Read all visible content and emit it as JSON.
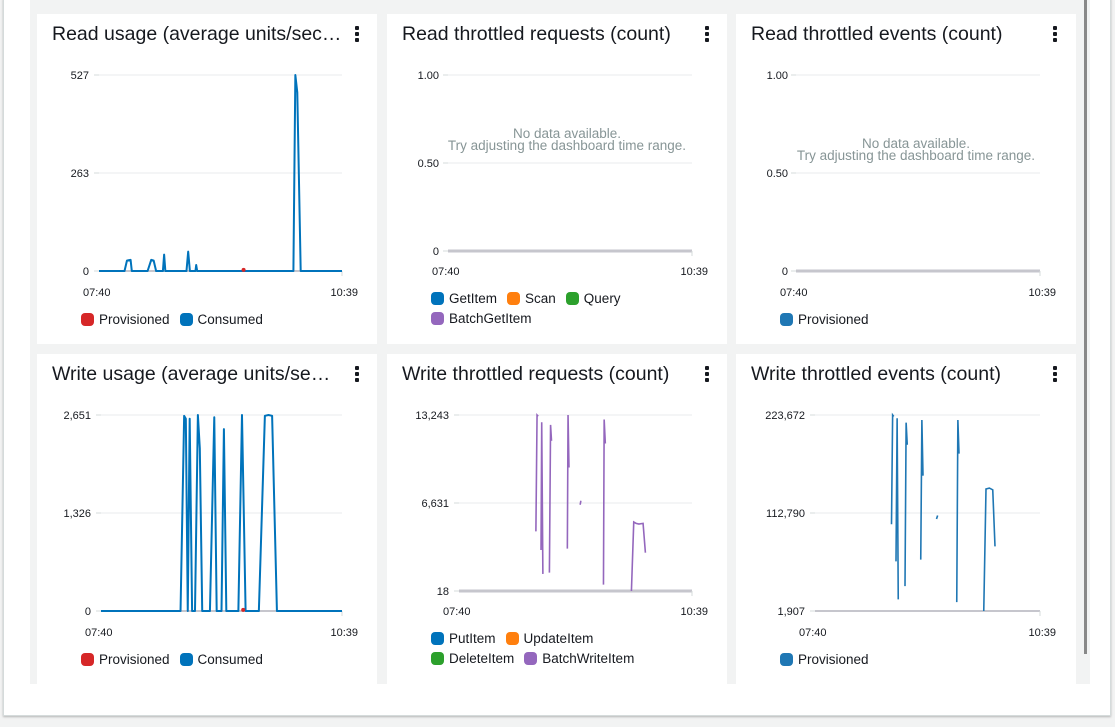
{
  "colors": {
    "blue": "#0073bb",
    "red": "#d62728",
    "orange": "#ff7f0e",
    "green": "#2ca02c",
    "purple": "#9467bd",
    "event_blue": "#1f77b4",
    "grid": "#e9ebed",
    "baseline": "#c6c6cd"
  },
  "no_data": {
    "line1": "No data available.",
    "line2": "Try adjusting the dashboard time range."
  },
  "chart_data": [
    {
      "id": "read-usage",
      "type": "line",
      "title": "Read usage (average units/sec…",
      "menu_icon": "more-vertical-icon",
      "xlabel": "",
      "ylabel": "",
      "x_ticks": [
        "07:40",
        "10:39"
      ],
      "y_ticks": [
        "527",
        "263",
        "0"
      ],
      "ylim": [
        0,
        527
      ],
      "legend": [
        {
          "name": "Provisioned",
          "color": "#d62728"
        },
        {
          "name": "Consumed",
          "color": "#0073bb"
        }
      ],
      "series": [
        {
          "name": "Consumed",
          "color": "#0073bb",
          "x": [
            0,
            0.105,
            0.115,
            0.13,
            0.135,
            0.2,
            0.215,
            0.225,
            0.235,
            0.263,
            0.268,
            0.273,
            0.36,
            0.367,
            0.374,
            0.397,
            0.4,
            0.404,
            0.8,
            0.808,
            0.816,
            0.83,
            1.0
          ],
          "y": [
            0,
            0,
            28,
            30,
            0,
            0,
            30,
            28,
            0,
            0,
            44,
            0,
            0,
            52,
            0,
            0,
            16,
            0,
            0,
            527,
            480,
            0,
            0
          ]
        },
        {
          "name": "Provisioned",
          "color": "#d62728",
          "points": [
            [
              0.595,
              3
            ]
          ]
        }
      ],
      "grid": true
    },
    {
      "id": "read-throttled-requests",
      "type": "line",
      "title": "Read throttled requests (count)",
      "menu_icon": "more-vertical-icon",
      "x_ticks": [
        "07:40",
        "10:39"
      ],
      "y_ticks": [
        "1.00",
        "0.50",
        "0"
      ],
      "ylim": [
        0,
        1
      ],
      "no_data": true,
      "legend": [
        {
          "name": "GetItem",
          "color": "#0073bb"
        },
        {
          "name": "Scan",
          "color": "#ff7f0e"
        },
        {
          "name": "Query",
          "color": "#2ca02c"
        },
        {
          "name": "BatchGetItem",
          "color": "#9467bd"
        }
      ],
      "series": [],
      "grid": true
    },
    {
      "id": "read-throttled-events",
      "type": "line",
      "title": "Read throttled events (count)",
      "menu_icon": "more-vertical-icon",
      "x_ticks": [
        "07:40",
        "10:39"
      ],
      "y_ticks": [
        "1.00",
        "0.50",
        "0"
      ],
      "ylim": [
        0,
        1
      ],
      "no_data": true,
      "legend": [
        {
          "name": "Provisioned",
          "color": "#1f77b4"
        }
      ],
      "series": [],
      "grid": true
    },
    {
      "id": "write-usage",
      "type": "line",
      "title": "Write usage (average units/se…",
      "menu_icon": "more-vertical-icon",
      "x_ticks": [
        "07:40",
        "10:39"
      ],
      "y_ticks": [
        "2,651",
        "1,326",
        "0"
      ],
      "ylim": [
        0,
        2651
      ],
      "legend": [
        {
          "name": "Provisioned",
          "color": "#d62728"
        },
        {
          "name": "Consumed",
          "color": "#0073bb"
        }
      ],
      "series": [
        {
          "name": "Consumed",
          "color": "#0073bb",
          "x": [
            0,
            0.33,
            0.345,
            0.352,
            0.36,
            0.368,
            0.378,
            0.39,
            0.402,
            0.41,
            0.42,
            0.44,
            0.452,
            0.47,
            0.48,
            0.5,
            0.51,
            0.52,
            0.535,
            0.558,
            0.57,
            0.585,
            0.6,
            0.615,
            0.618,
            0.63,
            0.64,
            0.655,
            0.68,
            0.695,
            0.71,
            0.73,
            1.0
          ],
          "y": [
            0,
            0,
            2640,
            2600,
            0,
            2600,
            0,
            0,
            2651,
            2200,
            0,
            0,
            0,
            2620,
            0,
            0,
            2460,
            0,
            0,
            0,
            0,
            2651,
            0,
            0,
            0,
            0,
            0,
            0,
            2640,
            2651,
            2640,
            0,
            0
          ]
        },
        {
          "name": "Provisioned",
          "color": "#d62728",
          "points": [
            [
              0.59,
              15
            ]
          ]
        }
      ],
      "grid": true
    },
    {
      "id": "write-throttled-requests",
      "type": "line",
      "title": "Write throttled requests (count)",
      "menu_icon": "more-vertical-icon",
      "x_ticks": [
        "07:40",
        "10:39"
      ],
      "y_ticks": [
        "13,243",
        "6,631",
        "18"
      ],
      "ylim": [
        18,
        13243
      ],
      "legend": [
        {
          "name": "PutItem",
          "color": "#0073bb"
        },
        {
          "name": "UpdateItem",
          "color": "#ff7f0e"
        },
        {
          "name": "DeleteItem",
          "color": "#2ca02c"
        },
        {
          "name": "BatchWriteItem",
          "color": "#9467bd"
        }
      ],
      "series": [
        {
          "name": "BatchWriteItem",
          "color": "#9467bd",
          "segments": [
            [
              [
                0.33,
                4500
              ],
              [
                0.335,
                13243
              ],
              [
                0.34,
                13150
              ]
            ],
            [
              [
                0.352,
                3100
              ],
              [
                0.355,
                12700
              ],
              [
                0.36,
                1300
              ]
            ],
            [
              [
                0.388,
                1400
              ],
              [
                0.393,
                12500
              ],
              [
                0.397,
                11300
              ]
            ],
            [
              [
                0.465,
                3200
              ],
              [
                0.468,
                13243
              ],
              [
                0.472,
                9300
              ]
            ],
            [
              [
                0.52,
                6500
              ],
              [
                0.523,
                6800
              ]
            ],
            [
              [
                0.62,
                500
              ],
              [
                0.623,
                12900
              ],
              [
                0.628,
                11100
              ]
            ],
            [
              [
                0.74,
                18
              ],
              [
                0.75,
                5200
              ],
              [
                0.76,
                5100
              ],
              [
                0.772,
                5050
              ],
              [
                0.79,
                5100
              ],
              [
                0.8,
                2900
              ]
            ]
          ]
        }
      ],
      "grid": true
    },
    {
      "id": "write-throttled-events",
      "type": "line",
      "title": "Write throttled events (count)",
      "menu_icon": "more-vertical-icon",
      "x_ticks": [
        "07:40",
        "10:39"
      ],
      "y_ticks": [
        "223,672",
        "112,790",
        "1,907"
      ],
      "ylim": [
        1907,
        223672
      ],
      "legend": [
        {
          "name": "Provisioned",
          "color": "#1f77b4"
        }
      ],
      "series": [
        {
          "name": "Provisioned",
          "color": "#1f77b4",
          "segments": [
            [
              [
                0.34,
                100000
              ],
              [
                0.345,
                223672
              ],
              [
                0.35,
                222000
              ]
            ],
            [
              [
                0.36,
                58000
              ],
              [
                0.365,
                220000
              ],
              [
                0.37,
                15000
              ]
            ],
            [
              [
                0.4,
                30000
              ],
              [
                0.405,
                215000
              ],
              [
                0.41,
                190000
              ]
            ],
            [
              [
                0.47,
                60000
              ],
              [
                0.475,
                218000
              ],
              [
                0.48,
                155000
              ]
            ],
            [
              [
                0.54,
                106000
              ],
              [
                0.545,
                110000
              ]
            ],
            [
              [
                0.63,
                12000
              ],
              [
                0.635,
                218000
              ],
              [
                0.64,
                180000
              ]
            ],
            [
              [
                0.75,
                1907
              ],
              [
                0.76,
                140000
              ],
              [
                0.775,
                141000
              ],
              [
                0.79,
                139000
              ],
              [
                0.8,
                75000
              ]
            ]
          ]
        }
      ],
      "grid": true
    }
  ]
}
